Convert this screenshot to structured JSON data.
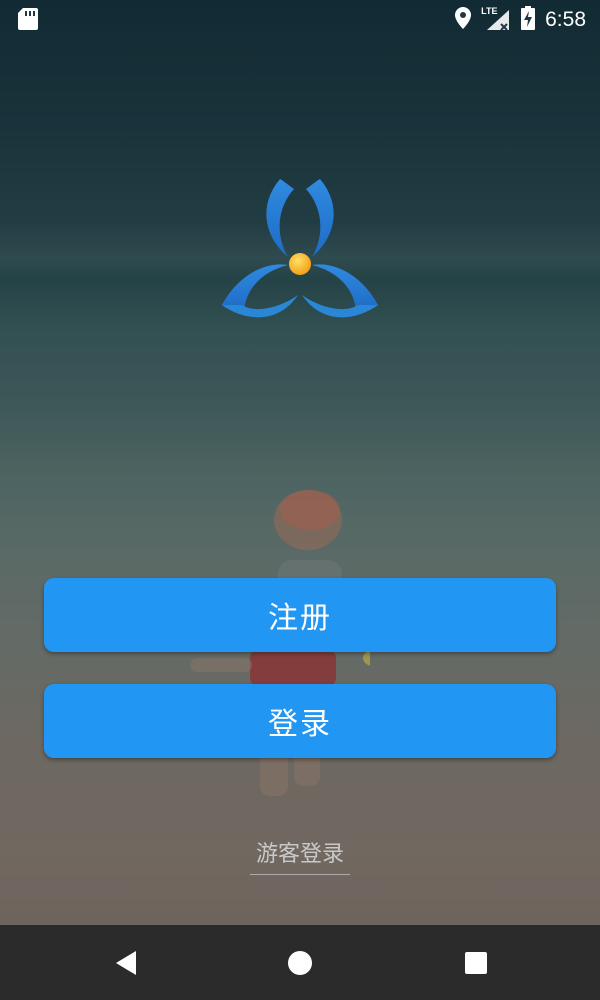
{
  "status_bar": {
    "time": "6:58",
    "network_label": "LTE",
    "icons": [
      "sd-card-icon",
      "location-icon",
      "signal-icon",
      "battery-charging-icon"
    ]
  },
  "logo": {
    "icon": "tri-petal-logo-icon"
  },
  "buttons": {
    "register_label": "注册",
    "login_label": "登录"
  },
  "guest_login_label": "游客登录",
  "nav_bar": {
    "icons": [
      "back-icon",
      "home-icon",
      "recent-apps-icon"
    ]
  },
  "colors": {
    "button": "#2196f3",
    "nav_bar": "#2b2b2b",
    "logo_blue": "#2a86d6",
    "logo_orange": "#f5a623"
  }
}
